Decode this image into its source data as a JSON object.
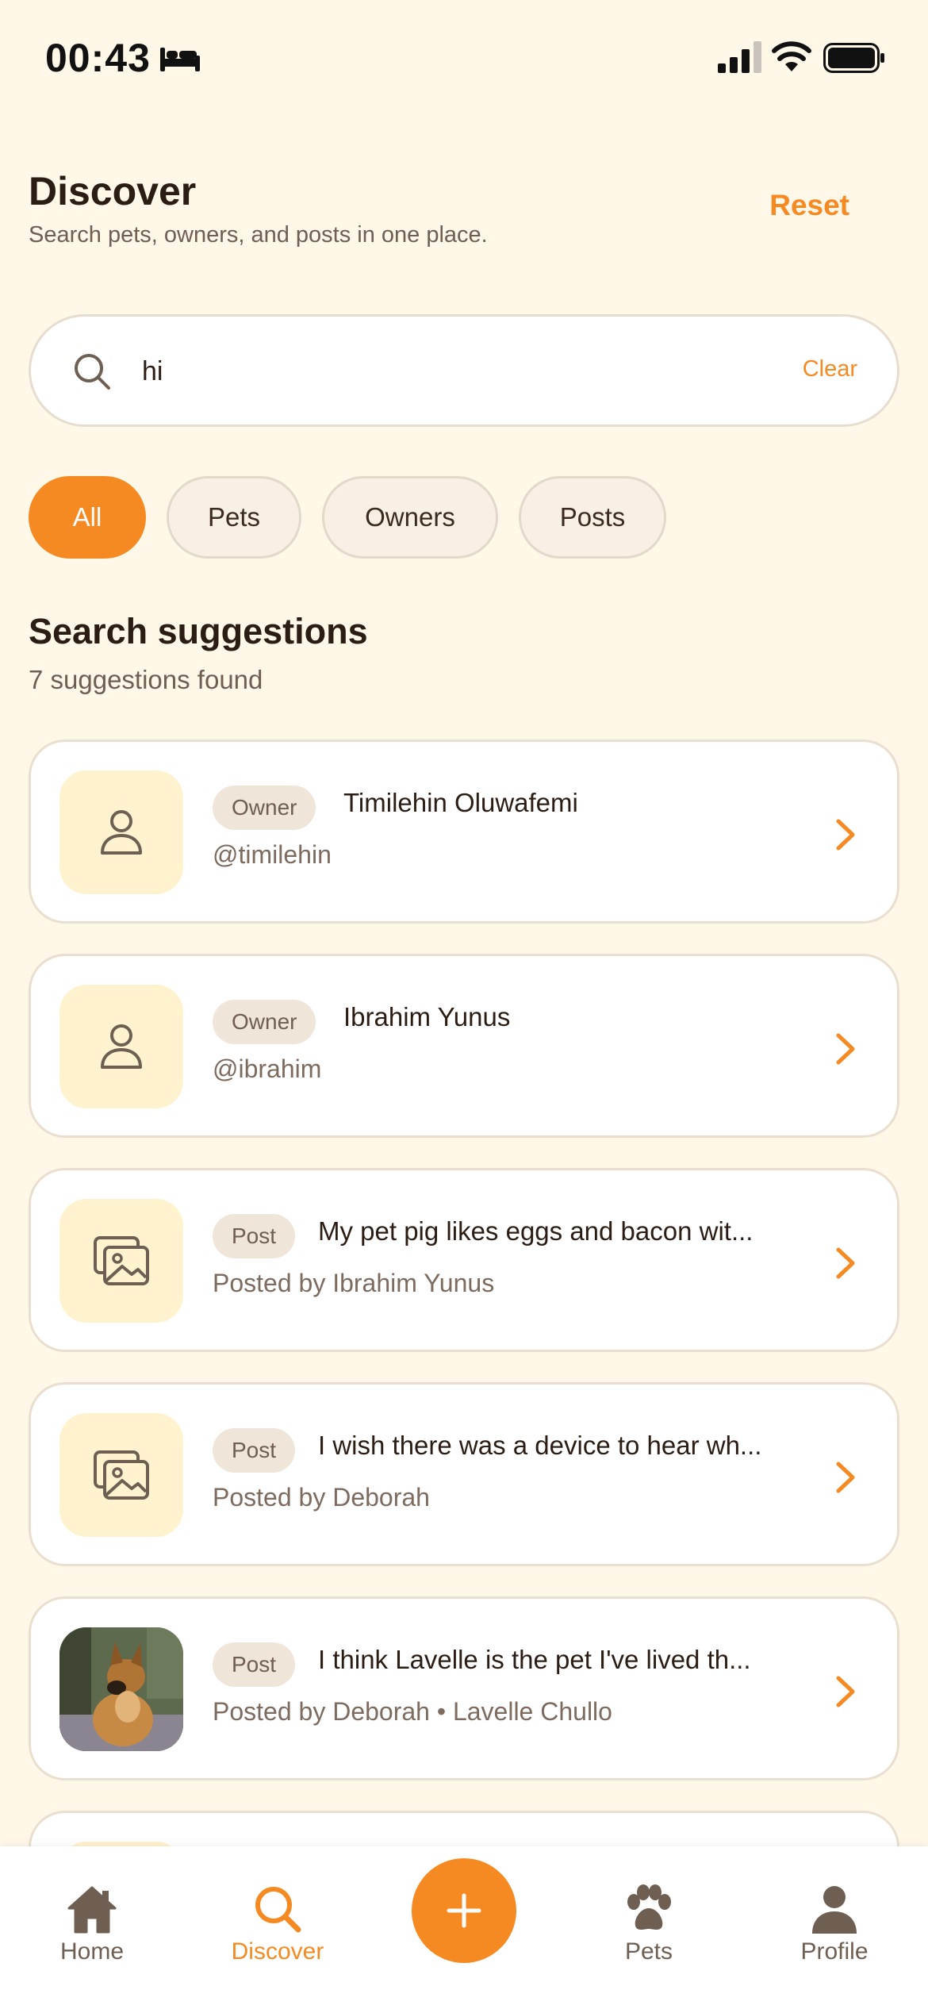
{
  "status_bar": {
    "time": "00:43"
  },
  "header": {
    "title": "Discover",
    "subtitle": "Search pets, owners, and posts in one place.",
    "reset_label": "Reset"
  },
  "search": {
    "value": "hi",
    "clear_label": "Clear"
  },
  "filters": [
    {
      "label": "All",
      "active": true
    },
    {
      "label": "Pets",
      "active": false
    },
    {
      "label": "Owners",
      "active": false
    },
    {
      "label": "Posts",
      "active": false
    }
  ],
  "suggestions": {
    "title": "Search suggestions",
    "count_text": "7 suggestions found",
    "items": [
      {
        "type": "Owner",
        "title": "Timilehin Oluwafemi",
        "subtitle": "@timilehin",
        "thumb": "person-icon"
      },
      {
        "type": "Owner",
        "title": "Ibrahim Yunus",
        "subtitle": "@ibrahim",
        "thumb": "person-icon"
      },
      {
        "type": "Post",
        "title": "My pet pig likes eggs and bacon wit...",
        "subtitle": "Posted by Ibrahim Yunus",
        "thumb": "image-stack-icon"
      },
      {
        "type": "Post",
        "title": "I wish there was a device to hear wh...",
        "subtitle": "Posted by Deborah",
        "thumb": "image-stack-icon"
      },
      {
        "type": "Post",
        "title": "I think Lavelle is the pet I've lived th...",
        "subtitle": "Posted by Deborah • Lavelle Chullo",
        "thumb": "dog-photo"
      }
    ]
  },
  "nav": {
    "home": "Home",
    "discover": "Discover",
    "pets": "Pets",
    "profile": "Profile",
    "active": "Discover"
  },
  "colors": {
    "accent": "#F68A22",
    "background": "#FFF7E8",
    "thumb_bg": "#FFF3CF",
    "text_dark": "#2B1D14",
    "text_muted": "#6F5E52"
  }
}
